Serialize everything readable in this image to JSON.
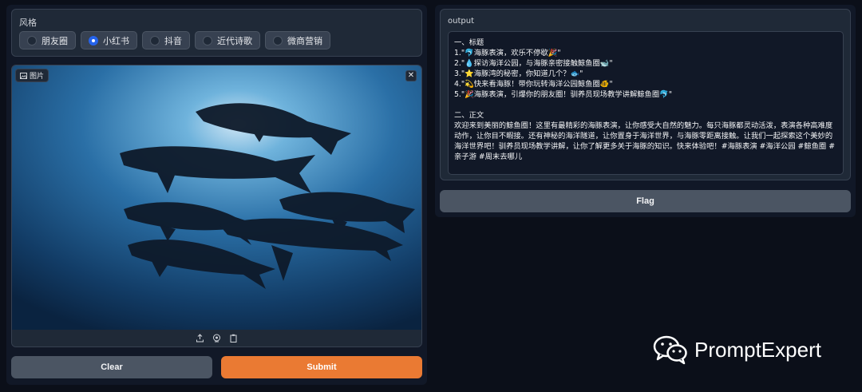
{
  "style": {
    "label": "风格",
    "options": [
      "朋友圈",
      "小红书",
      "抖音",
      "近代诗歌",
      "微商营销"
    ],
    "selected": "小红书"
  },
  "image": {
    "label": "图片",
    "close": "✕",
    "toolbar": [
      "upload-icon",
      "webcam-icon",
      "clipboard-icon"
    ]
  },
  "buttons": {
    "clear": "Clear",
    "submit": "Submit",
    "flag": "Flag"
  },
  "output": {
    "label": "output",
    "heading1": "一、标题",
    "titles": [
      "1.\"🐬海豚表演，欢乐不停歇🎉\"",
      "2.\"💧探访海洋公园，与海豚亲密接触鲸鱼圈🐋\"",
      "3.\"⭐海豚湾的秘密，你知道几个？🐟\"",
      "4.\"💫快来看海豚！带你玩转海洋公园鲸鱼圈🐠\"",
      "5.\"🎉海豚表演，引爆你的朋友圈！驯养员现场教学讲解鲸鱼圈🐬\""
    ],
    "heading2": "二、正文",
    "body": "欢迎来到美丽的鲸鱼圈！这里有最精彩的海豚表演，让你感受大自然的魅力。每只海豚都灵动活泼，表演各种高难度动作，让你目不暇接。还有神秘的海洋隧道，让你置身于海洋世界，与海豚零距离接触。让我们一起探索这个美妙的海洋世界吧！驯养员现场教学讲解，让你了解更多关于海豚的知识。快来体验吧！#海豚表演 #海洋公园 #鲸鱼圈 #亲子游 #周末去哪儿"
  },
  "watermark": {
    "text": "PromptExpert",
    "icon": "wechat-icon"
  },
  "colors": {
    "background": "#0b0f19",
    "panel": "#1f2937",
    "accent": "#ea7a33",
    "radio_selected": "#2563eb"
  }
}
